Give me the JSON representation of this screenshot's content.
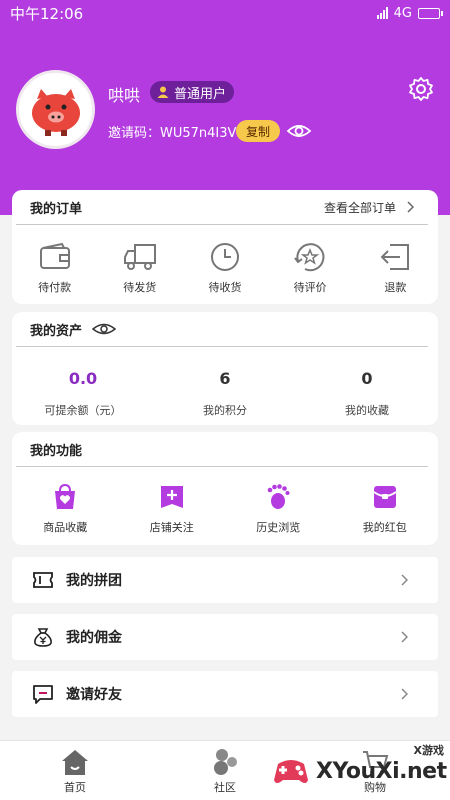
{
  "status_bar": {
    "time": "中午12:06",
    "network": "4G"
  },
  "profile": {
    "username": "哄哄",
    "badge": "普通用户",
    "invite_label": "邀请码：WU57n4I3V",
    "copy_label": "复制"
  },
  "orders": {
    "title": "我的订单",
    "view_all": "查看全部订单",
    "items": [
      {
        "icon": "wallet-icon",
        "label": "待付款"
      },
      {
        "icon": "truck-icon",
        "label": "待发货"
      },
      {
        "icon": "clock-icon",
        "label": "待收货"
      },
      {
        "icon": "star-review-icon",
        "label": "待评价"
      },
      {
        "icon": "return-icon",
        "label": "退款"
      }
    ]
  },
  "assets": {
    "title": "我的资产",
    "items": [
      {
        "value": "0.0",
        "label": "可提余额（元）"
      },
      {
        "value": "6",
        "label": "我的积分"
      },
      {
        "value": "0",
        "label": "我的收藏"
      }
    ]
  },
  "functions": {
    "title": "我的功能",
    "items": [
      {
        "icon": "heart-bag-icon",
        "label": "商品收藏"
      },
      {
        "icon": "shop-plus-icon",
        "label": "店铺关注"
      },
      {
        "icon": "footprint-icon",
        "label": "历史浏览"
      },
      {
        "icon": "red-envelope-icon",
        "label": "我的红包"
      }
    ]
  },
  "list": [
    {
      "icon": "ticket-icon",
      "label": "我的拼团"
    },
    {
      "icon": "money-bag-icon",
      "label": "我的佣金"
    },
    {
      "icon": "chat-invite-icon",
      "label": "邀请好友"
    }
  ],
  "tabbar": [
    {
      "icon": "home-icon",
      "label": "首页"
    },
    {
      "icon": "community-icon",
      "label": "社区"
    },
    {
      "icon": "cart-icon",
      "label": "购物"
    }
  ],
  "watermark": {
    "text": "XYouXi.net",
    "small": "X游戏"
  },
  "colors": {
    "primary": "#b33be0",
    "accent": "#8a2bc2",
    "badge": "#6e1f9a",
    "copy": "#f6c84c"
  }
}
